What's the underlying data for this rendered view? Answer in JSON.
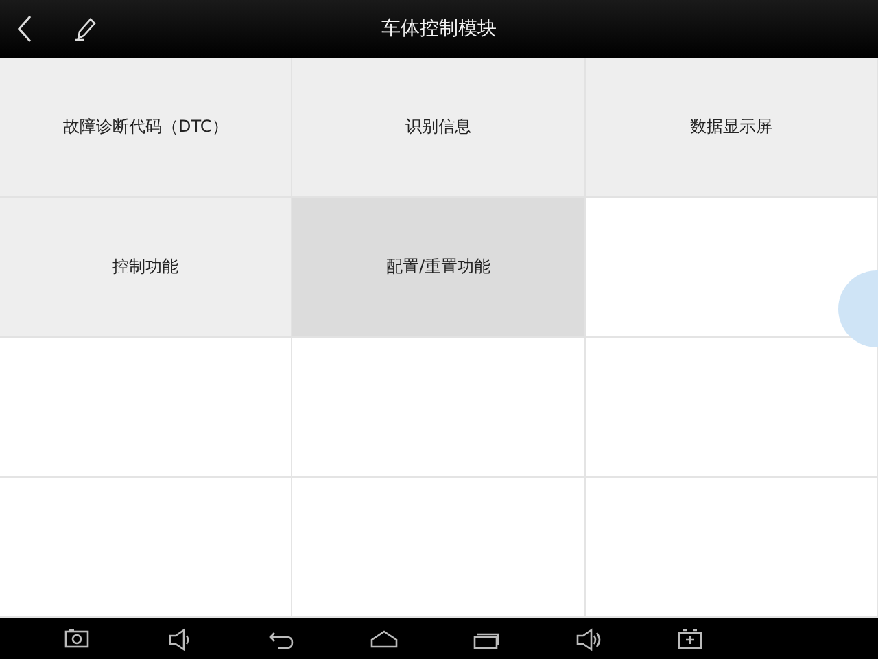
{
  "header": {
    "title": "车体控制模块"
  },
  "tiles": [
    {
      "label": "故障诊断代码（DTC）",
      "selected": false
    },
    {
      "label": "识别信息",
      "selected": false
    },
    {
      "label": "数据显示屏",
      "selected": false
    },
    {
      "label": "控制功能",
      "selected": false
    },
    {
      "label": "配置/重置功能",
      "selected": true
    }
  ]
}
